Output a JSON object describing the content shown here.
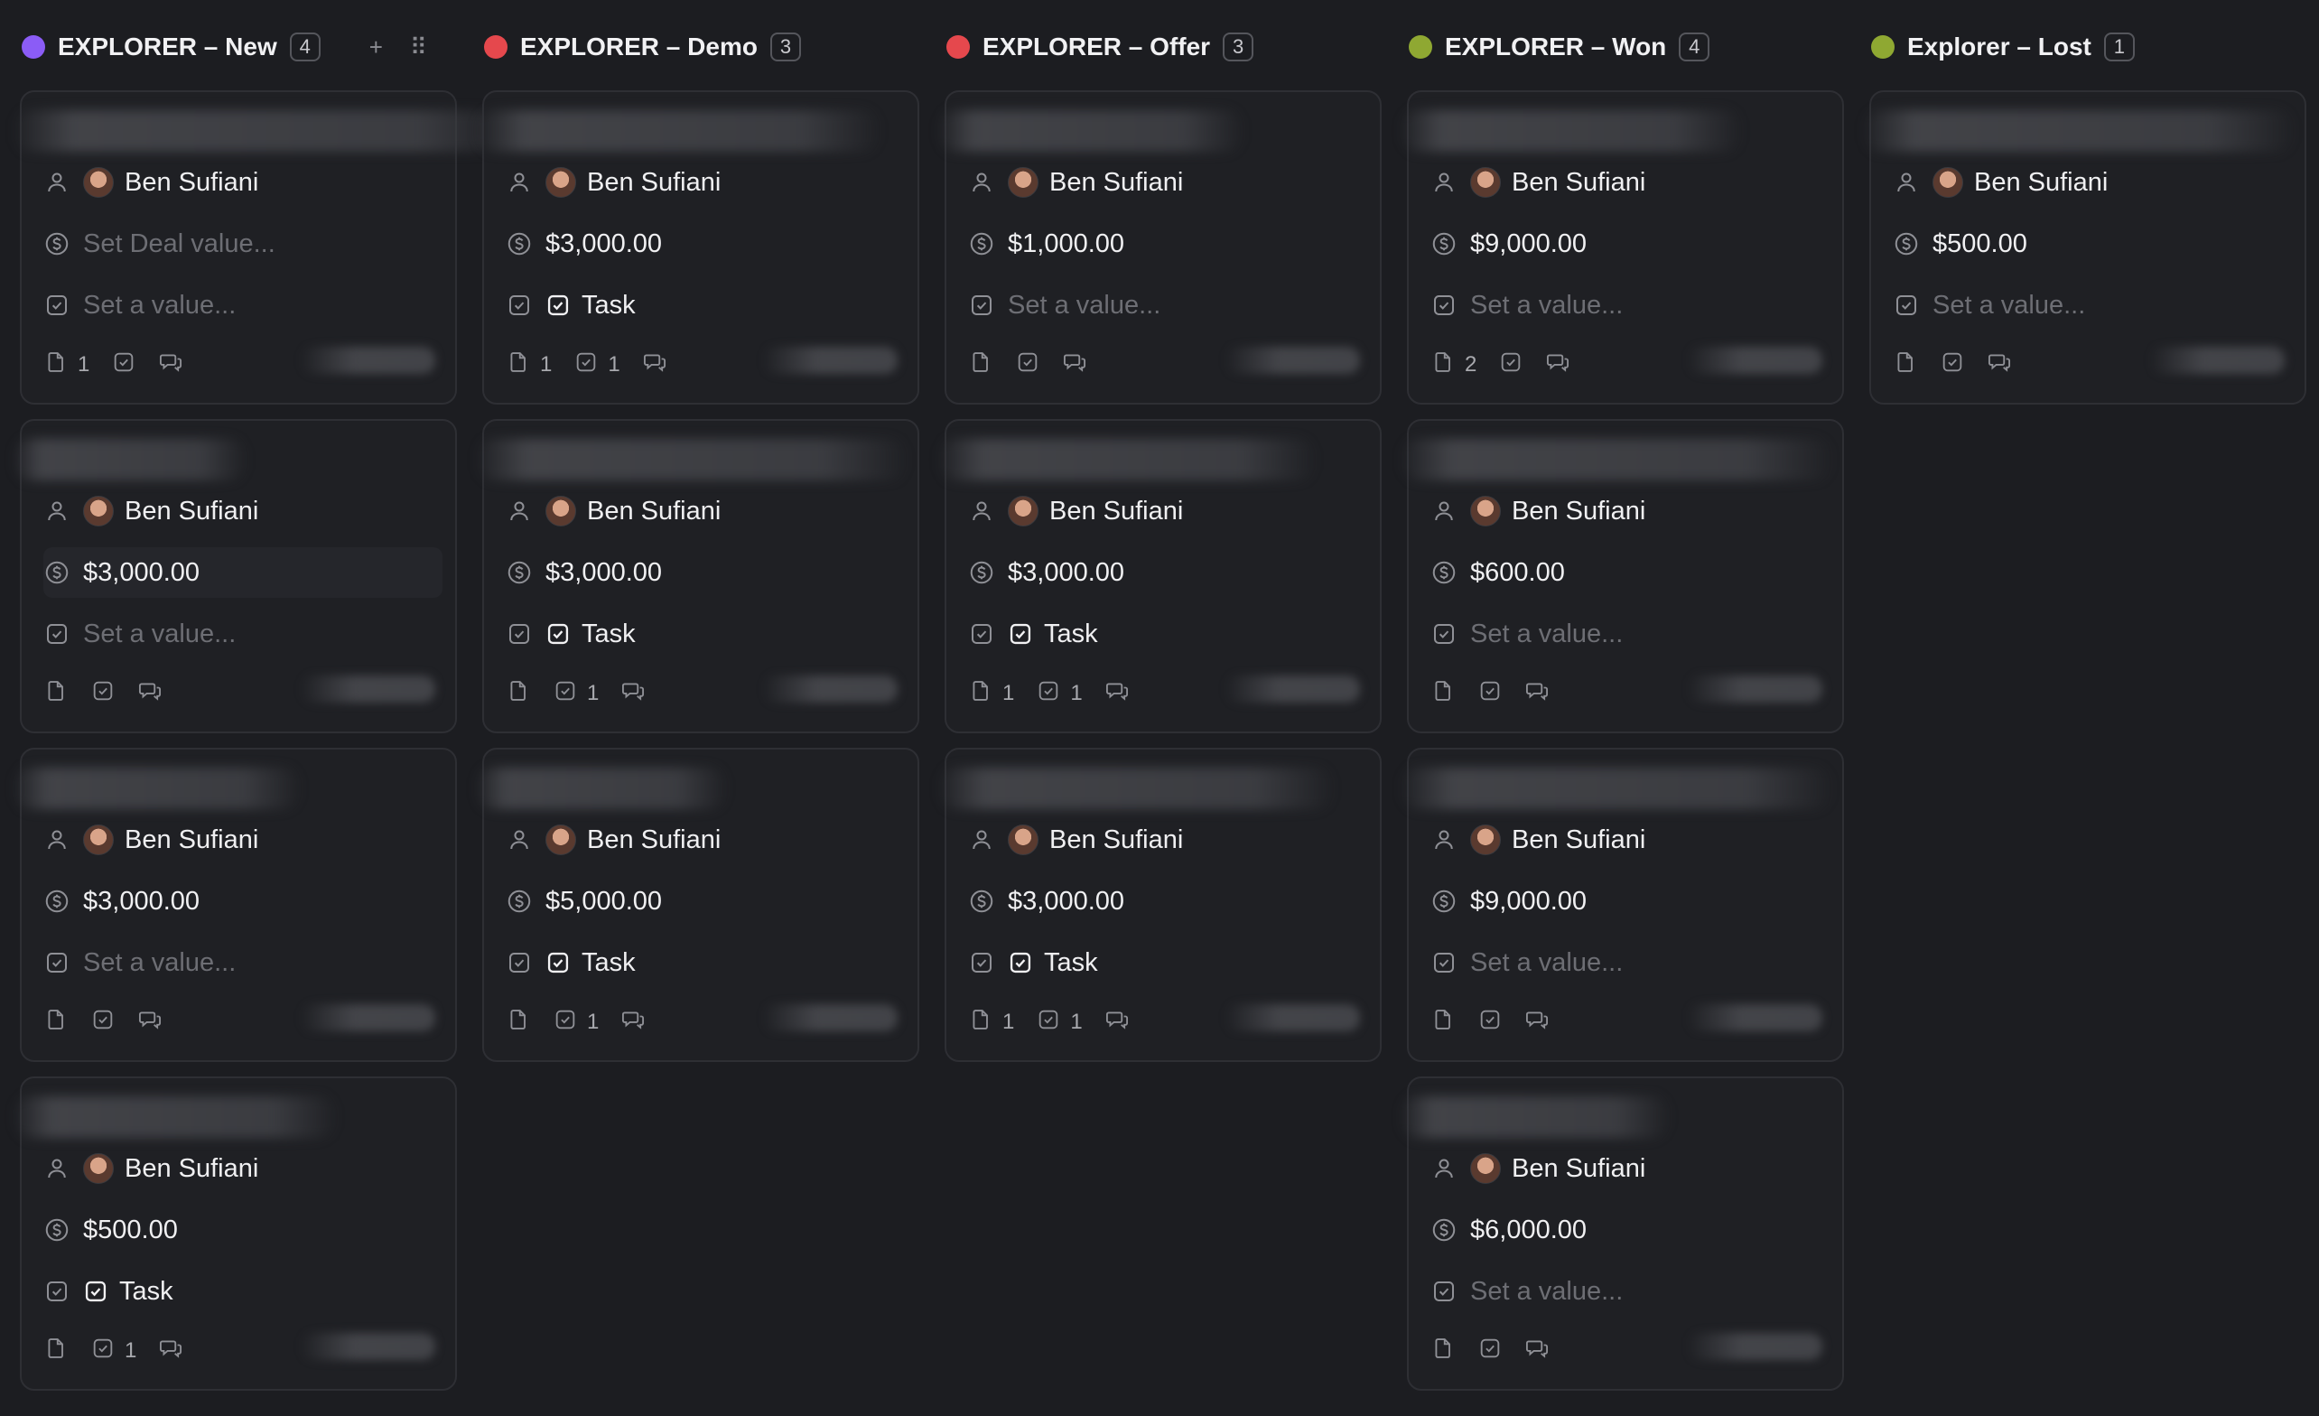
{
  "columns": [
    {
      "title": "EXPLORER – New",
      "count": "4",
      "color": "#8b5cf6",
      "show_actions": true,
      "cards": [
        {
          "owner": "Ben Sufiani",
          "value": "Set Deal value...",
          "value_placeholder": true,
          "task": "Set a value...",
          "task_checked": false,
          "files": "1",
          "tasks": "",
          "title_width": 560
        },
        {
          "owner": "Ben Sufiani",
          "value": "$3,000.00",
          "value_placeholder": false,
          "task": "Set a value...",
          "task_checked": false,
          "files": "",
          "tasks": "",
          "title_width": 260,
          "highlight_value": true
        },
        {
          "owner": "Ben Sufiani",
          "value": "$3,000.00",
          "value_placeholder": false,
          "task": "Set a value...",
          "task_checked": false,
          "files": "",
          "tasks": "",
          "title_width": 320
        },
        {
          "owner": "Ben Sufiani",
          "value": "$500.00",
          "value_placeholder": false,
          "task": "Task",
          "task_checked": true,
          "files": "",
          "tasks": "1",
          "title_width": 360
        }
      ]
    },
    {
      "title": "EXPLORER – Demo",
      "count": "3",
      "color": "#e5484d",
      "show_actions": false,
      "cards": [
        {
          "owner": "Ben Sufiani",
          "value": "$3,000.00",
          "value_placeholder": false,
          "task": "Task",
          "task_checked": true,
          "files": "1",
          "tasks": "1",
          "title_width": 450
        },
        {
          "owner": "Ben Sufiani",
          "value": "$3,000.00",
          "value_placeholder": false,
          "task": "Task",
          "task_checked": true,
          "files": "",
          "tasks": "1",
          "title_width": 480
        },
        {
          "owner": "Ben Sufiani",
          "value": "$5,000.00",
          "value_placeholder": false,
          "task": "Task",
          "task_checked": true,
          "files": "",
          "tasks": "1",
          "title_width": 280
        }
      ]
    },
    {
      "title": "EXPLORER – Offer",
      "count": "3",
      "color": "#e5484d",
      "show_actions": false,
      "cards": [
        {
          "owner": "Ben Sufiani",
          "value": "$1,000.00",
          "value_placeholder": false,
          "task": "Set a value...",
          "task_checked": false,
          "files": "",
          "tasks": "",
          "title_width": 340
        },
        {
          "owner": "Ben Sufiani",
          "value": "$3,000.00",
          "value_placeholder": false,
          "task": "Task",
          "task_checked": true,
          "files": "1",
          "tasks": "1",
          "title_width": 420
        },
        {
          "owner": "Ben Sufiani",
          "value": "$3,000.00",
          "value_placeholder": false,
          "task": "Task",
          "task_checked": true,
          "files": "1",
          "tasks": "1",
          "title_width": 440
        }
      ]
    },
    {
      "title": "EXPLORER – Won",
      "count": "4",
      "color": "#8fa832",
      "show_actions": false,
      "cards": [
        {
          "owner": "Ben Sufiani",
          "value": "$9,000.00",
          "value_placeholder": false,
          "task": "Set a value...",
          "task_checked": false,
          "files": "2",
          "tasks": "",
          "title_width": 380
        },
        {
          "owner": "Ben Sufiani",
          "value": "$600.00",
          "value_placeholder": false,
          "task": "Set a value...",
          "task_checked": false,
          "files": "",
          "tasks": "",
          "title_width": 480
        },
        {
          "owner": "Ben Sufiani",
          "value": "$9,000.00",
          "value_placeholder": false,
          "task": "Set a value...",
          "task_checked": false,
          "files": "",
          "tasks": "",
          "title_width": 480
        },
        {
          "owner": "Ben Sufiani",
          "value": "$6,000.00",
          "value_placeholder": false,
          "task": "Set a value...",
          "task_checked": false,
          "files": "",
          "tasks": "",
          "title_width": 300
        }
      ]
    },
    {
      "title": "Explorer – Lost",
      "count": "1",
      "color": "#8fa832",
      "show_actions": false,
      "cards": [
        {
          "owner": "Ben Sufiani",
          "value": "$500.00",
          "value_placeholder": false,
          "task": "Set a value...",
          "task_checked": false,
          "files": "",
          "tasks": "",
          "title_width": 480
        }
      ]
    }
  ],
  "header_actions": {
    "add": "+",
    "drag": "⠿"
  }
}
